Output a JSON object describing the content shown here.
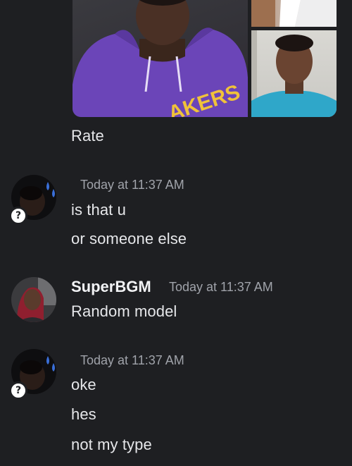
{
  "messages": [
    {
      "lines": [
        "Rate"
      ]
    },
    {
      "timestamp": "Today at 11:37 AM",
      "avatar_icon": "dark-user-avatar-with-water-drops",
      "badge": "?",
      "lines": [
        "is that u",
        "or someone else"
      ]
    },
    {
      "username": "SuperBGM",
      "timestamp": "Today at 11:37 AM",
      "avatar_icon": "user-avatar-red-hair",
      "lines": [
        "Random model"
      ]
    },
    {
      "timestamp": "Today at 11:37 AM",
      "avatar_icon": "dark-user-avatar-with-water-drops",
      "badge": "?",
      "lines": [
        "oke",
        "hes",
        "not my type"
      ]
    }
  ],
  "attachments": {
    "count": 3,
    "main_text": "AKERS"
  },
  "colors": {
    "background": "#1e1f22",
    "text": "#e6e7ea",
    "timestamp": "#a0a3aa",
    "hoodie": "#6b45b8",
    "hoodie_letters": "#f0c23a",
    "shirt": "#2fa7c9"
  }
}
